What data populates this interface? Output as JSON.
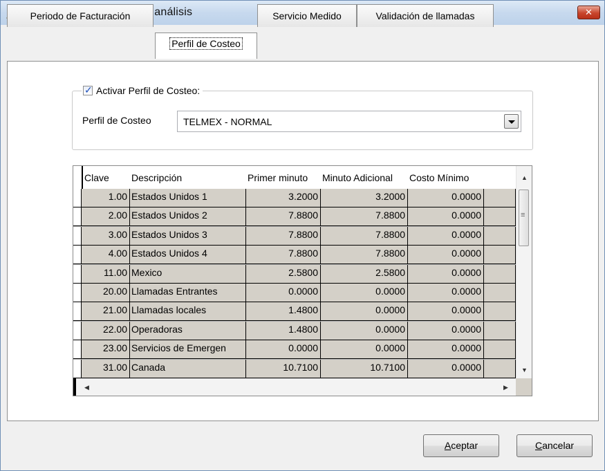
{
  "window": {
    "title": "Opciones del proceso de análisis",
    "close_glyph": "✕"
  },
  "tabs": [
    {
      "label": "Periodo de Facturación",
      "active": false
    },
    {
      "label": "Perfil de Costeo",
      "active": true
    },
    {
      "label": "Servicio Medido",
      "active": false
    },
    {
      "label": "Validación de llamadas",
      "active": false
    }
  ],
  "costing": {
    "enable_label": "Activar Perfil de Costeo:",
    "enabled": true,
    "profile_label": "Perfil de Costeo",
    "profile_value": "TELMEX - NORMAL"
  },
  "table": {
    "columns": [
      "Clave",
      "Descripción",
      "Primer minuto",
      "Minuto Adicional",
      "Costo Mínimo"
    ],
    "rows": [
      [
        "1.00",
        "Estados Unidos 1",
        "3.2000",
        "3.2000",
        "0.0000"
      ],
      [
        "2.00",
        "Estados Unidos 2",
        "7.8800",
        "7.8800",
        "0.0000"
      ],
      [
        "3.00",
        "Estados Unidos 3",
        "7.8800",
        "7.8800",
        "0.0000"
      ],
      [
        "4.00",
        "Estados Unidos 4",
        "7.8800",
        "7.8800",
        "0.0000"
      ],
      [
        "11.00",
        "Mexico",
        "2.5800",
        "2.5800",
        "0.0000"
      ],
      [
        "20.00",
        "Llamadas Entrantes",
        "0.0000",
        "0.0000",
        "0.0000"
      ],
      [
        "21.00",
        "Llamadas locales",
        "1.4800",
        "0.0000",
        "0.0000"
      ],
      [
        "22.00",
        "Operadoras",
        "1.4800",
        "0.0000",
        "0.0000"
      ],
      [
        "23.00",
        "Servicios de Emergen",
        "0.0000",
        "0.0000",
        "0.0000"
      ],
      [
        "31.00",
        "Canada",
        "10.7100",
        "10.7100",
        "0.0000"
      ]
    ]
  },
  "buttons": {
    "accept_underline": "A",
    "accept_rest": "ceptar",
    "cancel_underline": "C",
    "cancel_rest": "ancelar"
  },
  "colors": {
    "titlebar": "#c7d9ee",
    "close": "#c8452c",
    "grid_cell": "#d4d0c8",
    "checkbox_tick": "#1a4cb8"
  }
}
